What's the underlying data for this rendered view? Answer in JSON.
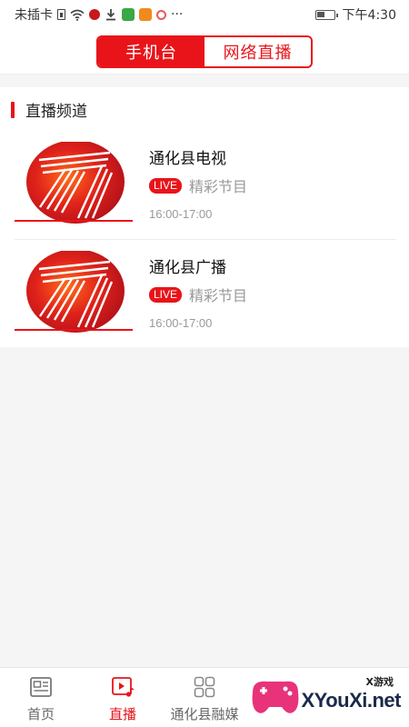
{
  "status_bar": {
    "carrier": "未插卡",
    "dots": "···",
    "time": "下午4:30"
  },
  "header": {
    "tabs": [
      {
        "label": "手机台",
        "active": true
      },
      {
        "label": "网络直播",
        "active": false
      }
    ]
  },
  "section": {
    "title": "直播频道"
  },
  "channels": [
    {
      "name": "通化县电视",
      "badge": "LIVE",
      "program": "精彩节目",
      "time": "16:00-17:00",
      "thumbnail_icon": "tonghua-logo-icon"
    },
    {
      "name": "通化县广播",
      "badge": "LIVE",
      "program": "精彩节目",
      "time": "16:00-17:00",
      "thumbnail_icon": "tonghua-logo-icon"
    }
  ],
  "bottom_nav": {
    "items": [
      {
        "label": "首页",
        "icon": "news-icon",
        "active": false
      },
      {
        "label": "直播",
        "icon": "live-play-icon",
        "active": true
      },
      {
        "label": "通化县融媒",
        "icon": "grid-icon",
        "active": false
      }
    ]
  },
  "watermark": {
    "tag": "X游戏",
    "logo": "XYouXi.net"
  },
  "colors": {
    "accent": "#e8141a",
    "muted": "#999999",
    "background": "#f5f5f5"
  }
}
